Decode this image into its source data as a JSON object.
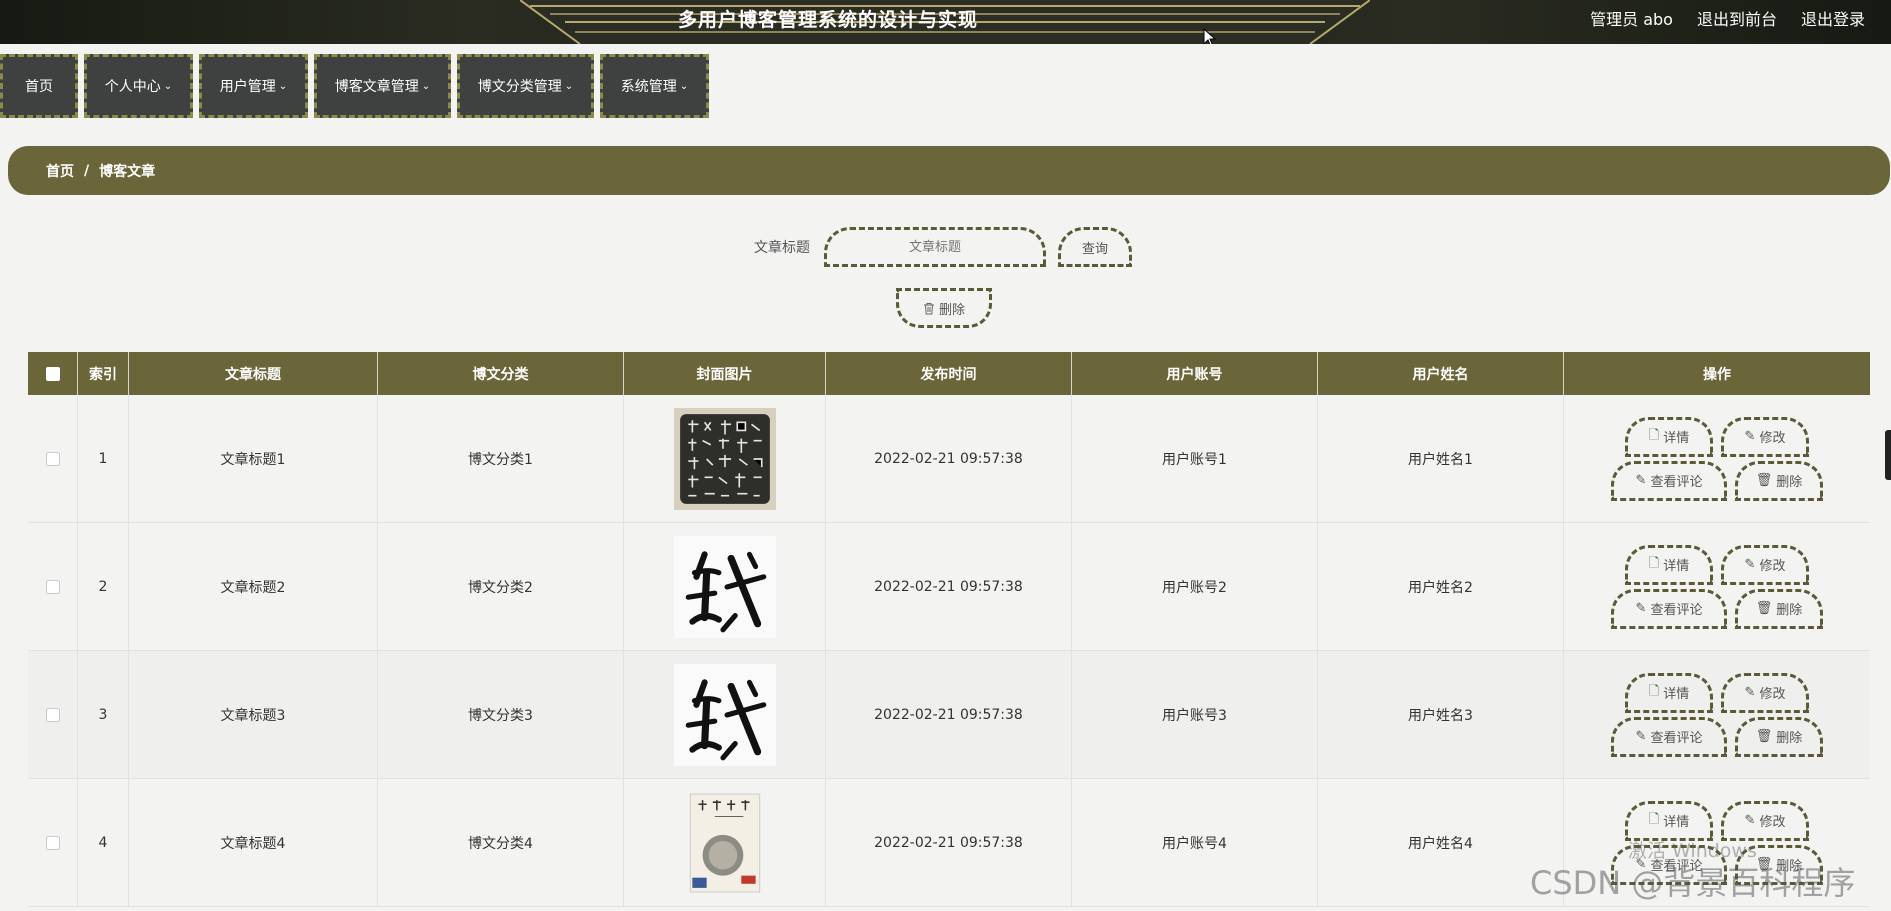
{
  "header": {
    "title": "多用户博客管理系统的设计与实现",
    "admin_label": "管理员 abo",
    "back_label": "退出到前台",
    "logout_label": "退出登录"
  },
  "nav": [
    {
      "label": "首页"
    },
    {
      "label": "个人中心"
    },
    {
      "label": "用户管理"
    },
    {
      "label": "博客文章管理"
    },
    {
      "label": "博文分类管理"
    },
    {
      "label": "系统管理"
    }
  ],
  "breadcrumb": {
    "home": "首页",
    "sep": "/",
    "current": "博客文章"
  },
  "search": {
    "label": "文章标题",
    "placeholder": "文章标题",
    "query_label": "查询",
    "delete_label": "删除"
  },
  "table": {
    "headers": [
      "索引",
      "文章标题",
      "博文分类",
      "封面图片",
      "发布时间",
      "用户账号",
      "用户姓名",
      "操作"
    ],
    "rows": [
      {
        "index": "1",
        "title": "文章标题1",
        "category": "博文分类1",
        "time": "2022-02-21 09:57:38",
        "account": "用户账号1",
        "name": "用户姓名1",
        "cover": "calligraphy-rubbing"
      },
      {
        "index": "2",
        "title": "文章标题2",
        "category": "博文分类2",
        "time": "2022-02-21 09:57:38",
        "account": "用户账号2",
        "name": "用户姓名2",
        "cover": "calligraphy-character"
      },
      {
        "index": "3",
        "title": "文章标题3",
        "category": "博文分类3",
        "time": "2022-02-21 09:57:38",
        "account": "用户账号3",
        "name": "用户姓名3",
        "cover": "calligraphy-character"
      },
      {
        "index": "4",
        "title": "文章标题4",
        "category": "博文分类4",
        "time": "2022-02-21 09:57:38",
        "account": "用户账号4",
        "name": "用户姓名4",
        "cover": "book-cover"
      }
    ],
    "ops": {
      "detail": "详情",
      "edit": "修改",
      "comments": "查看评论",
      "delete": "删除"
    }
  },
  "watermark": {
    "windows": "激活 Windows",
    "csdn": "CSDN @背景百科程序"
  },
  "colors": {
    "accent": "#6b6639",
    "nav_bg": "#3f4141",
    "header_bg": "#1c1e18"
  }
}
